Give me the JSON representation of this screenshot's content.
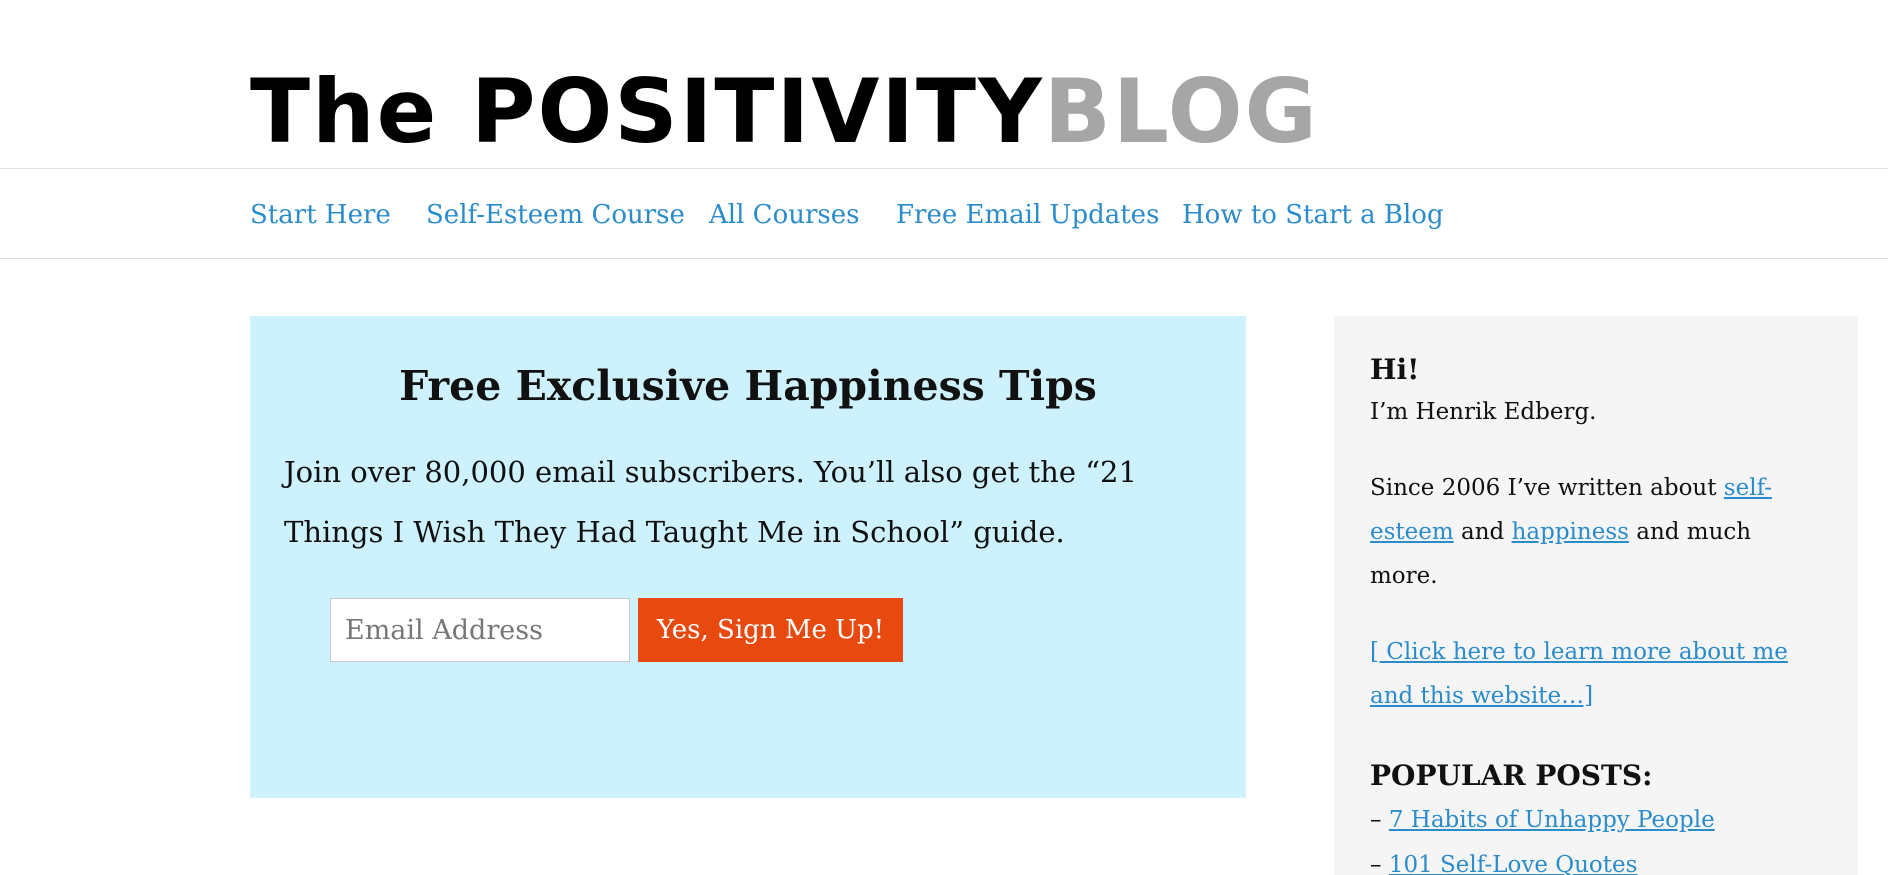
{
  "header": {
    "logo_the": "The ",
    "logo_positivity": "POSITIVITY",
    "logo_blog": "BLOG"
  },
  "nav": {
    "items": [
      "Start Here",
      "Self-Esteem Course",
      "All Courses",
      "Free Email Updates",
      "How to Start a Blog"
    ]
  },
  "optin": {
    "title": "Free Exclusive Happiness Tips",
    "body": "Join over 80,000 email subscribers. You’ll also get the “21 Things I Wish They Had Taught Me in School” guide.",
    "email_placeholder": "Email Address",
    "submit_label": "Yes, Sign Me Up!",
    "background_color": "#cdf1fd",
    "button_color": "#e8490f"
  },
  "sidebar": {
    "greeting": "Hi!",
    "intro": "I’m Henrik Edberg.",
    "since_text": "Since 2006 I’ve written about ",
    "link_self_esteem": "self-esteem",
    "and_text": " and ",
    "link_happiness": "happiness",
    "much_more_text": " and much more.",
    "about_link": "[ Click here to learn more about me and this website…]",
    "popular_heading": "POPULAR POSTS:",
    "dash": "– ",
    "popular_posts": [
      "7 Habits of Unhappy People",
      "101 Self-Love Quotes"
    ],
    "link_color": "#2b8ccc"
  }
}
